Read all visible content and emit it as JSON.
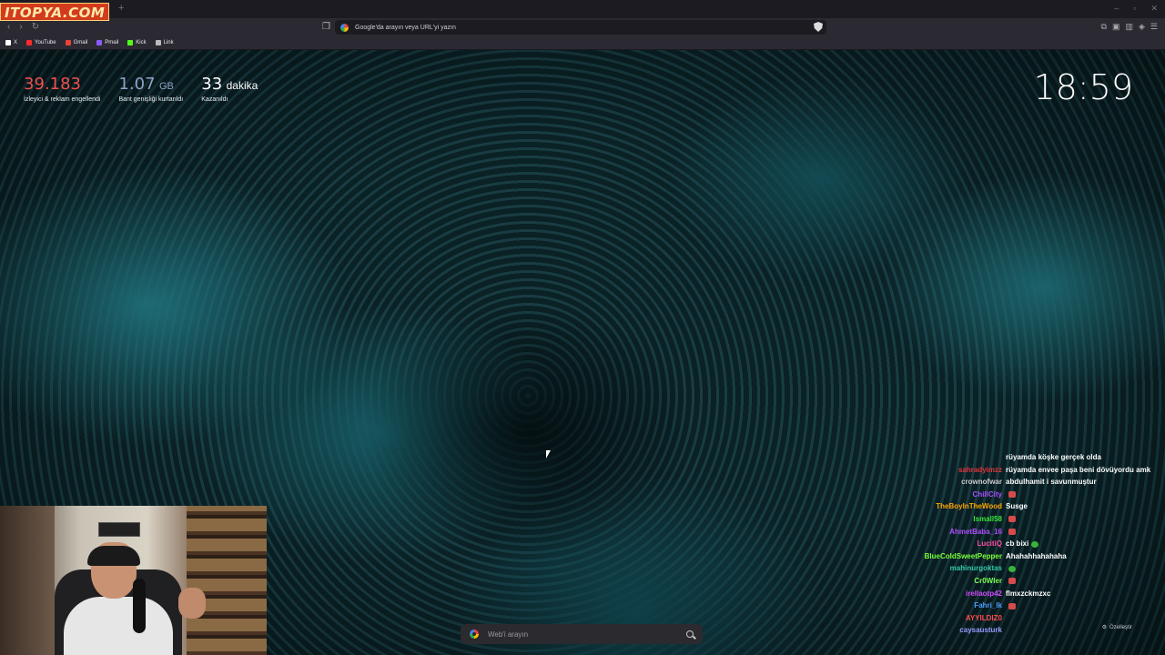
{
  "watermark": "ITOPYA.COM",
  "browser": {
    "new_tab": "+",
    "window_controls": [
      "–",
      "▫",
      "✕"
    ],
    "nav": [
      "‹",
      "›",
      "↻"
    ],
    "url_placeholder": "Google'da arayın veya URL'yi yazın",
    "bookmarks": [
      {
        "label": "X",
        "icon": "x-icon",
        "color": "#ffffff"
      },
      {
        "label": "YouTube",
        "icon": "youtube-icon",
        "color": "#ff2b2b"
      },
      {
        "label": "Gmail",
        "icon": "gmail-icon",
        "color": "#ea4335"
      },
      {
        "label": "Pmail",
        "icon": "pmail-icon",
        "color": "#8b5cf6"
      },
      {
        "label": "Kick",
        "icon": "kick-icon",
        "color": "#53fc18"
      },
      {
        "label": "Link",
        "icon": "link-icon",
        "color": "#bbbbbb"
      }
    ]
  },
  "stats": {
    "ads": {
      "value": "39.183",
      "label": "İzleyici & reklam engellendi"
    },
    "bandwidth": {
      "value": "1.07",
      "unit": "GB",
      "label": "Bant genişliği kurtarıldı"
    },
    "time": {
      "value": "33",
      "unit": "dakika",
      "label": "Kazanıldı"
    }
  },
  "clock": "18:59",
  "chat": [
    {
      "user": "",
      "color": "#ffffff",
      "msg": "rüyamda köşke gerçek olda"
    },
    {
      "user": "sahradyimzz",
      "color": "#e0343a",
      "msg": "rüyamda envee paşa beni dövüyordu amk"
    },
    {
      "user": "crownofwar",
      "color": "#cccccc",
      "msg": "abdulhamit i savunmuştur"
    },
    {
      "user": "ChillCity",
      "color": "#a64dff",
      "msg": "",
      "emote": "r"
    },
    {
      "user": "TheBoyInTheWood",
      "color": "#ffa500",
      "msg": "Susge"
    },
    {
      "user": "Ismall58",
      "color": "#39e639",
      "msg": "",
      "emote": "r"
    },
    {
      "user": "AhmetBaba_16",
      "color": "#b14dff",
      "msg": "",
      "emote": "r"
    },
    {
      "user": "LucitiQ",
      "color": "#ff4da6",
      "msg": "cb bixi",
      "emote": "g"
    },
    {
      "user": "BlueColdSweetPepper",
      "color": "#7bff3a",
      "msg": "Ahahahhahahaha"
    },
    {
      "user": "mahinurgoktas",
      "color": "#33ccaa",
      "msg": "",
      "emote": "g"
    },
    {
      "user": "Cr0Wler",
      "color": "#7aff55",
      "msg": "",
      "emote": "r"
    },
    {
      "user": "irellaotp42",
      "color": "#d04dff",
      "msg": "flmxzckmzxc"
    },
    {
      "user": "Fahri_lk",
      "color": "#4d9dff",
      "msg": "",
      "emote": "r"
    },
    {
      "user": "AYYILDIZ0",
      "color": "#ff4d4d",
      "msg": ""
    },
    {
      "user": "caysausturk",
      "color": "#9a9aff",
      "msg": ""
    }
  ],
  "search": {
    "placeholder": "Web'i arayın"
  },
  "customize": "Özelleştir"
}
